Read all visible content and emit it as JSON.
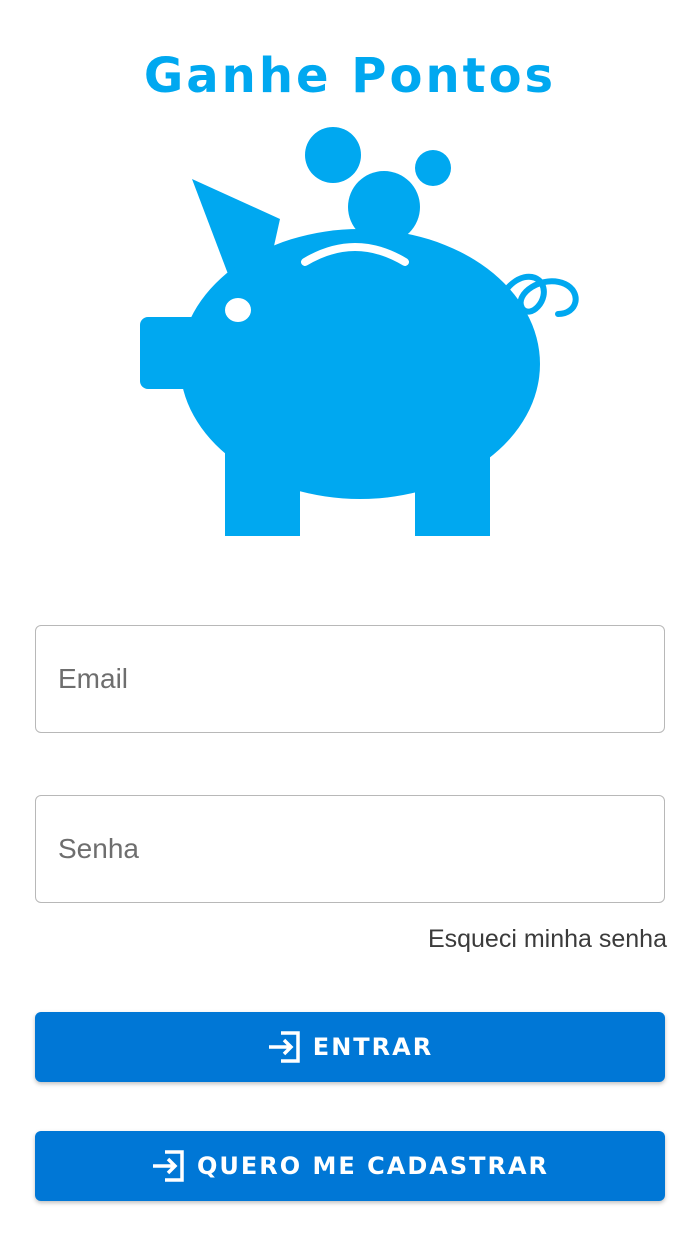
{
  "app": {
    "title": "Ganhe Pontos"
  },
  "logo": {
    "icon": "piggy-bank-icon"
  },
  "form": {
    "email_placeholder": "Email",
    "email_value": "",
    "password_placeholder": "Senha",
    "password_value": "",
    "forgot_password_label": "Esqueci minha senha"
  },
  "buttons": {
    "login_label": "ENTRAR",
    "login_icon": "login-icon",
    "register_label": "QUERO ME CADASTRAR",
    "register_icon": "login-icon"
  },
  "colors": {
    "brand": "#00a8f0",
    "button": "#0077d6"
  }
}
